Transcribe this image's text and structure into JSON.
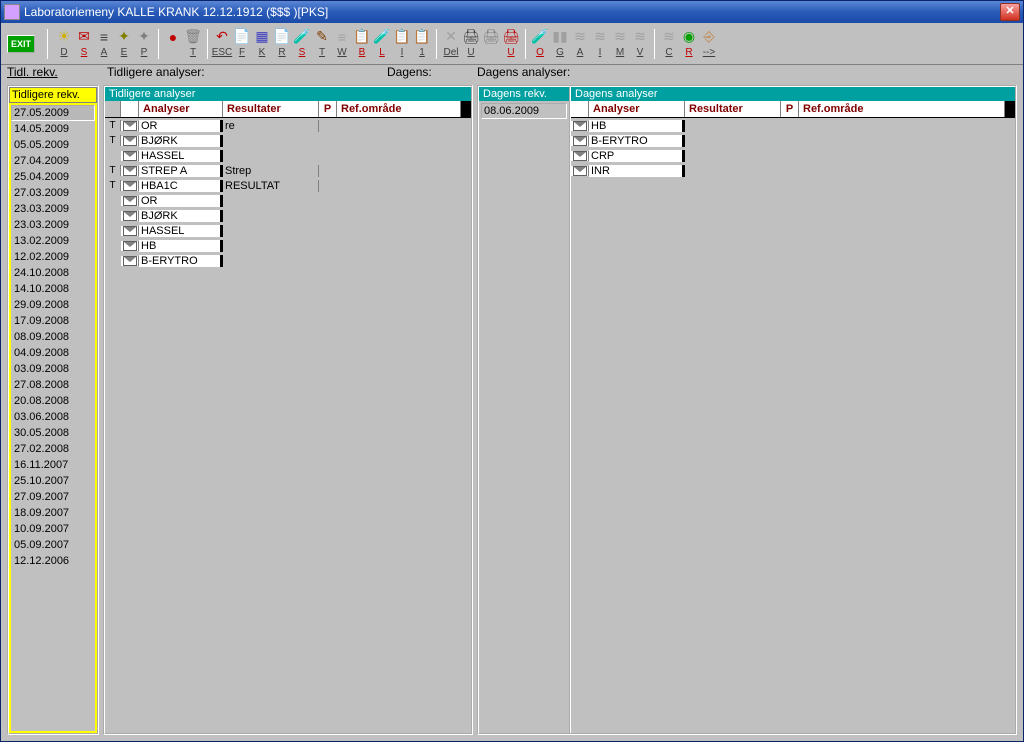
{
  "window": {
    "title": "Laboratoriemeny KALLE KRANK 12.12.1912 ($$$ )[PKS]"
  },
  "toolbar": {
    "exit": "EXIT",
    "buttons": [
      {
        "letter": "D",
        "icon": "☀",
        "color": "#d0b000"
      },
      {
        "letter": "S",
        "icon": "✉",
        "color": "#c00000"
      },
      {
        "letter": "A",
        "icon": "≡",
        "color": "#404040"
      },
      {
        "letter": "E",
        "icon": "✦",
        "color": "#808000"
      },
      {
        "letter": "P",
        "icon": "✦",
        "color": "#808080"
      },
      {
        "letter": "",
        "icon": "●",
        "color": "#c00000"
      },
      {
        "letter": "T",
        "icon": "🗑",
        "color": "#808080"
      },
      {
        "letter": "ESC",
        "icon": "↶",
        "color": "#c00000"
      },
      {
        "letter": "F",
        "icon": "📄",
        "color": "#c0a000"
      },
      {
        "letter": "K",
        "icon": "▦",
        "color": "#4040c0"
      },
      {
        "letter": "R",
        "icon": "📄",
        "color": "#c0a000"
      },
      {
        "letter": "S",
        "icon": "🧪",
        "color": "#c00000"
      },
      {
        "letter": "T",
        "icon": "✎",
        "color": "#804000"
      },
      {
        "letter": "W",
        "icon": "≡",
        "color": "#a0a0a0"
      },
      {
        "letter": "B",
        "icon": "📋",
        "color": "#c00000"
      },
      {
        "letter": "L",
        "icon": "🧪",
        "color": "#c00000"
      },
      {
        "letter": "I",
        "icon": "📋",
        "color": "#c0a000"
      },
      {
        "letter": "1",
        "icon": "📋",
        "color": "#4080c0"
      },
      {
        "letter": "Del",
        "icon": "✕",
        "color": "#a0a0a0"
      },
      {
        "letter": "U",
        "icon": "🖨",
        "color": "#404040"
      },
      {
        "letter": "",
        "icon": "🖨",
        "color": "#808080"
      },
      {
        "letter": "U",
        "icon": "🖨",
        "color": "#c00000"
      },
      {
        "letter": "O",
        "icon": "🧪",
        "color": "#c00000"
      },
      {
        "letter": "G",
        "icon": "▮▮",
        "color": "#a0a0a0"
      },
      {
        "letter": "A",
        "icon": "≋",
        "color": "#a0a0a0"
      },
      {
        "letter": "I",
        "icon": "≋",
        "color": "#a0a0a0"
      },
      {
        "letter": "M",
        "icon": "≋",
        "color": "#a0a0a0"
      },
      {
        "letter": "V",
        "icon": "≋",
        "color": "#a0a0a0"
      },
      {
        "letter": "C",
        "icon": "≋",
        "color": "#a0a0a0"
      },
      {
        "letter": "R",
        "icon": "◉",
        "color": "#00a000"
      },
      {
        "letter": "-->",
        "icon": "⎆",
        "color": "#c08040"
      }
    ]
  },
  "sections": {
    "tidl_rekv": "Tidl. rekv.",
    "tidligere_analyser": "Tidligere analyser:",
    "dagens": "Dagens:",
    "dagens_analyser": "Dagens analyser:"
  },
  "tidl": {
    "header": "Tidligere rekv.",
    "dates": [
      "27.05.2009",
      "14.05.2009",
      "05.05.2009",
      "27.04.2009",
      "25.04.2009",
      "27.03.2009",
      "23.03.2009",
      "23.03.2009",
      "13.02.2009",
      "12.02.2009",
      "24.10.2008",
      "14.10.2008",
      "29.09.2008",
      "17.09.2008",
      "08.09.2008",
      "04.09.2008",
      "03.09.2008",
      "27.08.2008",
      "20.08.2008",
      "03.06.2008",
      "30.05.2008",
      "27.02.2008",
      "16.11.2007",
      "25.10.2007",
      "27.09.2007",
      "18.09.2007",
      "10.09.2007",
      "05.09.2007",
      "12.12.2006"
    ],
    "selected_index": 0
  },
  "left_table": {
    "title": "Tidligere analyser",
    "columns": {
      "analyser": "Analyser",
      "resultater": "Resultater",
      "p": "P",
      "ref": "Ref.område"
    },
    "rows": [
      {
        "t": "T",
        "name": "OR",
        "res": "re"
      },
      {
        "t": "T",
        "name": "BJØRK",
        "res": ""
      },
      {
        "t": "",
        "name": "HASSEL",
        "res": ""
      },
      {
        "t": "T",
        "name": "STREP A",
        "res": "Strep"
      },
      {
        "t": "T",
        "name": "HBA1C",
        "res": "RESULTAT"
      },
      {
        "t": "",
        "name": "OR",
        "res": ""
      },
      {
        "t": "",
        "name": "BJØRK",
        "res": ""
      },
      {
        "t": "",
        "name": "HASSEL",
        "res": ""
      },
      {
        "t": "",
        "name": "HB",
        "res": ""
      },
      {
        "t": "",
        "name": "B-ERYTRO",
        "res": ""
      }
    ]
  },
  "dagens_rekv": {
    "title": "Dagens rekv.",
    "date": "08.06.2009"
  },
  "right_table": {
    "title": "Dagens analyser",
    "columns": {
      "analyser": "Analyser",
      "resultater": "Resultater",
      "p": "P",
      "ref": "Ref.område"
    },
    "rows": [
      {
        "name": "HB"
      },
      {
        "name": "B-ERYTRO"
      },
      {
        "name": "CRP"
      },
      {
        "name": "INR"
      }
    ]
  }
}
